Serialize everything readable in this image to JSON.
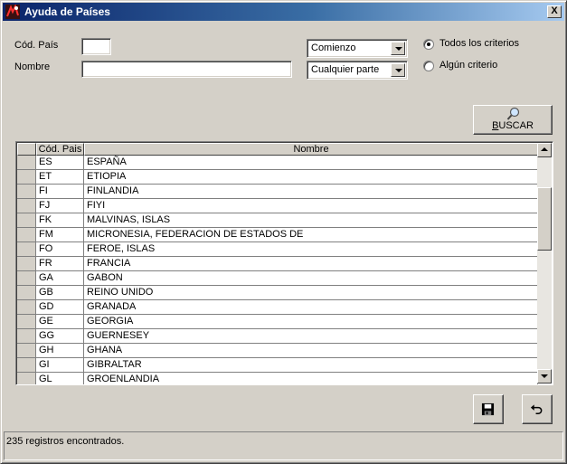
{
  "window": {
    "title": "Ayuda de Países",
    "close_label": "X"
  },
  "form": {
    "cod_label": "Cód. País",
    "cod_value": "",
    "nombre_label": "Nombre",
    "nombre_value": "",
    "cod_match": "Comienzo",
    "nombre_match": "Cualquier parte",
    "criteria_all": "Todos los criterios",
    "criteria_any": "Algún criterio",
    "criteria_selected": "all"
  },
  "search_button": {
    "label_underlined": "B",
    "label_rest": "USCAR"
  },
  "grid": {
    "columns": [
      "Cód. Pais",
      "Nombre"
    ],
    "rows": [
      {
        "code": "ES",
        "name": "ESPAÑA"
      },
      {
        "code": "ET",
        "name": "ETIOPIA"
      },
      {
        "code": "FI",
        "name": "FINLANDIA"
      },
      {
        "code": "FJ",
        "name": "FIYI"
      },
      {
        "code": "FK",
        "name": "MALVINAS, ISLAS"
      },
      {
        "code": "FM",
        "name": "MICRONESIA, FEDERACION DE ESTADOS DE"
      },
      {
        "code": "FO",
        "name": "FEROE, ISLAS"
      },
      {
        "code": "FR",
        "name": "FRANCIA"
      },
      {
        "code": "GA",
        "name": "GABON"
      },
      {
        "code": "GB",
        "name": "REINO UNIDO"
      },
      {
        "code": "GD",
        "name": "GRANADA"
      },
      {
        "code": "GE",
        "name": "GEORGIA"
      },
      {
        "code": "GG",
        "name": "GUERNESEY"
      },
      {
        "code": "GH",
        "name": "GHANA"
      },
      {
        "code": "GI",
        "name": "GIBRALTAR"
      },
      {
        "code": "GL",
        "name": "GROENLANDIA"
      }
    ],
    "scroll_fraction": 0.2
  },
  "icons": {
    "app": "app-icon",
    "search": "magnifier-icon",
    "save": "floppy-disk-icon",
    "undo": "undo-arrow-icon"
  },
  "status": {
    "text": "235 registros encontrados."
  },
  "colors": {
    "title_start": "#0a246a",
    "title_end": "#a6caf0",
    "face": "#d4d0c8"
  }
}
